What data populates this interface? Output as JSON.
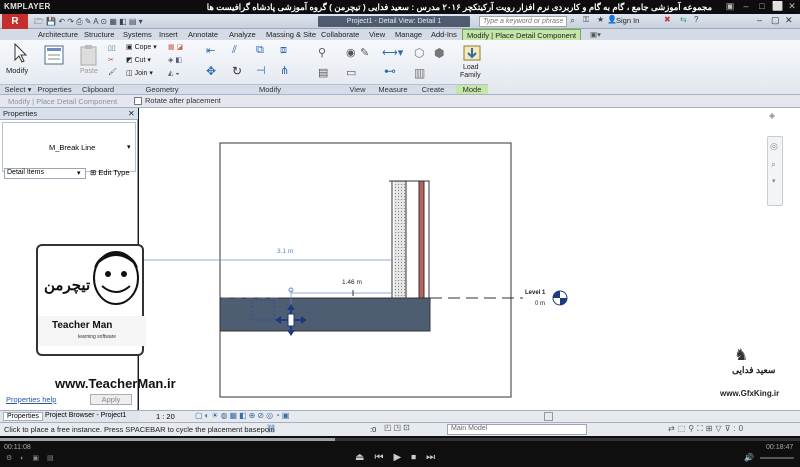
{
  "player": {
    "logo": "KMPLAYER",
    "title": "مجموعه آموزشی جامع ، گام به گام و کاربردی نرم افزار رویت آرکیتکچر ۲۰۱۶  مدرس : سعید فدایی ( تیچرمن ) گروه آموزشی پادشاه گرافیست ها",
    "time_current": "00:11:08",
    "time_total": "00:18:47"
  },
  "revit": {
    "project_title": "Project1 - Detail View: Detail 1",
    "search_placeholder": "Type a keyword or phrase",
    "sign_in": "Sign In",
    "tabs": [
      "Architecture",
      "Structure",
      "Systems",
      "Insert",
      "Annotate",
      "Analyze",
      "Massing & Site",
      "Collaborate",
      "View",
      "Manage",
      "Add-Ins",
      "Modify | Place Detail Component"
    ],
    "panels": [
      "Select ▾",
      "Properties",
      "Clipboard",
      "Geometry",
      "Modify",
      "View",
      "Measure",
      "Create",
      "Mode"
    ],
    "buttons": {
      "modify": "Modify",
      "paste": "Paste",
      "cope": "Cope",
      "cut": "Cut",
      "join": "Join",
      "load_family_1": "Load",
      "load_family_2": "Family"
    },
    "options_bar": {
      "context": "Modify | Place Detail Component",
      "rotate_label": "Rotate after placement"
    },
    "properties": {
      "header": "Properties",
      "type_name": "M_Break Line",
      "filter": "Detail Items",
      "edit_type": "Edit Type",
      "help": "Properties help",
      "apply": "Apply",
      "tab_properties": "Properties",
      "tab_browser": "Project Browser - Project1"
    },
    "drawing": {
      "dim1": "3.1 m",
      "dim2": "1.46 m",
      "level_name": "Level 1",
      "level_value": "0 m"
    },
    "view_scale": "1 : 20",
    "status_text": "Click to place a free instance. Press SPACEBAR to cycle the placement basepoin",
    "status_zero": ":0",
    "main_model": "Main Model"
  },
  "watermark": {
    "site": "www.TeacherMan.ir",
    "brand": "Teacher Man",
    "brand_sub": "learning software",
    "logo_fa": "تیچرمن",
    "gfx_name": "سعید فدایی",
    "gfx_site": "www.GfxKing.ir"
  },
  "colors": {
    "accent": "#c3e7a7",
    "slab": "#4e5d72",
    "brick": "#b5625a"
  }
}
